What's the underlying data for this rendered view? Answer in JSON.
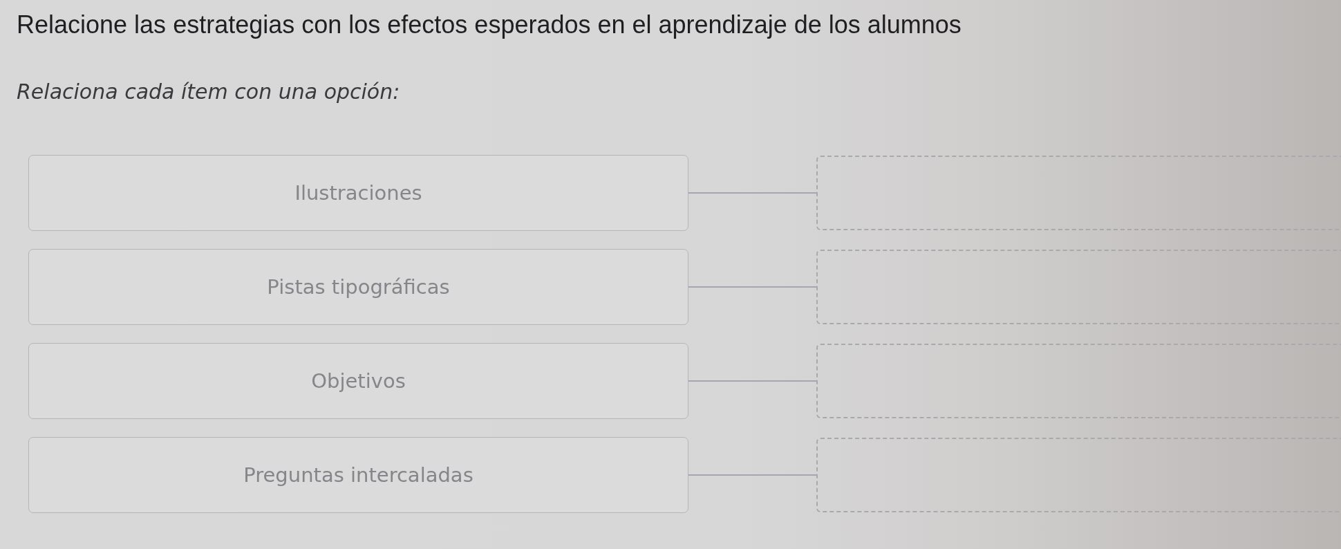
{
  "title": "Relacione las estrategias con los efectos esperados en el aprendizaje de los alumnos",
  "instruction": "Relaciona cada ítem con una opción:",
  "pairs": [
    {
      "item": "Ilustraciones"
    },
    {
      "item": "Pistas tipográficas"
    },
    {
      "item": "Objetivos"
    },
    {
      "item": "Preguntas intercaladas"
    }
  ]
}
